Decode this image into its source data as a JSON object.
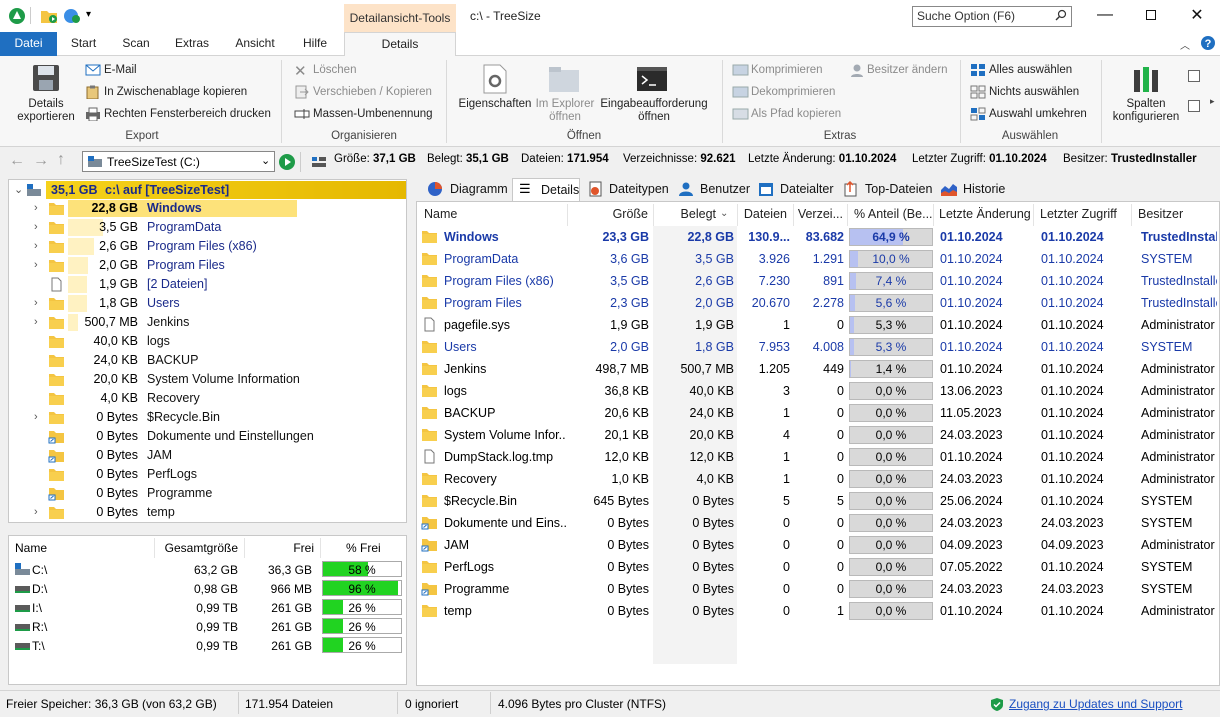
{
  "window": {
    "title": "c:\\ - TreeSize",
    "context_tab": "Detailansicht-Tools",
    "search_placeholder": "Suche Option (F6)"
  },
  "ribbon_tabs": [
    "Datei",
    "Start",
    "Scan",
    "Extras",
    "Ansicht",
    "Hilfe",
    "Details"
  ],
  "ribbon": {
    "export": {
      "group": "Export",
      "details_export": "Details\nexportieren",
      "email": "E-Mail",
      "clipboard": "In Zwischenablage kopieren",
      "print": "Rechten Fensterbereich drucken"
    },
    "organize": {
      "group": "Organisieren",
      "delete": "Löschen",
      "move": "Verschieben / Kopieren",
      "rename": "Massen-Umbenennung"
    },
    "open": {
      "group": "Öffnen",
      "properties": "Eigenschaften",
      "explorer": "Im Explorer\nöffnen",
      "cmd": "Eingabeaufforderung\nöffnen"
    },
    "extras": {
      "group": "Extras",
      "compress": "Komprimieren",
      "decompress": "Dekomprimieren",
      "copy_path": "Als Pfad kopieren",
      "owner": "Besitzer ändern"
    },
    "select": {
      "group": "Auswählen",
      "all": "Alles auswählen",
      "none": "Nichts auswählen",
      "invert": "Auswahl umkehren"
    },
    "columns": {
      "label": "Spalten\nkonfigurieren"
    }
  },
  "address": {
    "drive": "TreeSizeTest (C:)",
    "stats": [
      {
        "label": "Größe:",
        "value": "37,1 GB"
      },
      {
        "label": "Belegt:",
        "value": "35,1 GB"
      },
      {
        "label": "Dateien:",
        "value": "171.954"
      },
      {
        "label": "Verzeichnisse:",
        "value": "92.621"
      },
      {
        "label": "Letzte Änderung:",
        "value": "01.10.2024"
      },
      {
        "label": "Letzter Zugriff:",
        "value": "01.10.2024"
      },
      {
        "label": "Besitzer:",
        "value": "TrustedInstaller"
      }
    ]
  },
  "tree": {
    "root": {
      "size": "35,1 GB",
      "label": "c:\\  auf  [TreeSizeTest]"
    },
    "items": [
      {
        "size": "22,8 GB",
        "name": "Windows",
        "pct": 64.9,
        "exp": true,
        "icon": "folder"
      },
      {
        "size": "3,5 GB",
        "name": "ProgramData",
        "pct": 10.0,
        "exp": true,
        "icon": "folder"
      },
      {
        "size": "2,6 GB",
        "name": "Program Files (x86)",
        "pct": 7.4,
        "exp": true,
        "icon": "folder"
      },
      {
        "size": "2,0 GB",
        "name": "Program Files",
        "pct": 5.6,
        "exp": true,
        "icon": "folder"
      },
      {
        "size": "1,9 GB",
        "name": "[2 Dateien]",
        "pct": 5.3,
        "exp": false,
        "icon": "file"
      },
      {
        "size": "1,8 GB",
        "name": "Users",
        "pct": 5.3,
        "exp": true,
        "icon": "folder"
      },
      {
        "size": "500,7 MB",
        "name": "Jenkins",
        "pct": 1.4,
        "exp": true,
        "icon": "folder"
      },
      {
        "size": "40,0 KB",
        "name": "logs",
        "pct": 0,
        "exp": false,
        "icon": "folder"
      },
      {
        "size": "24,0 KB",
        "name": "BACKUP",
        "pct": 0,
        "exp": false,
        "icon": "folder"
      },
      {
        "size": "20,0 KB",
        "name": "System Volume Information",
        "pct": 0,
        "exp": false,
        "icon": "folder"
      },
      {
        "size": "4,0 KB",
        "name": "Recovery",
        "pct": 0,
        "exp": false,
        "icon": "folder"
      },
      {
        "size": "0 Bytes",
        "name": "$Recycle.Bin",
        "pct": 0,
        "exp": true,
        "icon": "folder"
      },
      {
        "size": "0 Bytes",
        "name": "Dokumente und Einstellungen",
        "pct": 0,
        "exp": false,
        "icon": "link"
      },
      {
        "size": "0 Bytes",
        "name": "JAM",
        "pct": 0,
        "exp": false,
        "icon": "link"
      },
      {
        "size": "0 Bytes",
        "name": "PerfLogs",
        "pct": 0,
        "exp": false,
        "icon": "folder"
      },
      {
        "size": "0 Bytes",
        "name": "Programme",
        "pct": 0,
        "exp": false,
        "icon": "link"
      },
      {
        "size": "0 Bytes",
        "name": "temp",
        "pct": 0,
        "exp": true,
        "icon": "folder"
      }
    ]
  },
  "drives": {
    "headers": [
      "Name",
      "Gesamtgröße",
      "Frei",
      "% Frei"
    ],
    "rows": [
      {
        "name": "C:\\",
        "total": "63,2 GB",
        "free": "36,3 GB",
        "pct": "58 %",
        "pct_val": 58
      },
      {
        "name": "D:\\",
        "total": "0,98 GB",
        "free": "966 MB",
        "pct": "96 %",
        "pct_val": 96
      },
      {
        "name": "I:\\",
        "total": "0,99 TB",
        "free": "261 GB",
        "pct": "26 %",
        "pct_val": 26
      },
      {
        "name": "R:\\",
        "total": "0,99 TB",
        "free": "261 GB",
        "pct": "26 %",
        "pct_val": 26
      },
      {
        "name": "T:\\",
        "total": "0,99 TB",
        "free": "261 GB",
        "pct": "26 %",
        "pct_val": 26
      }
    ]
  },
  "view_tabs": [
    "Diagramm",
    "Details",
    "Dateitypen",
    "Benutzer",
    "Dateialter",
    "Top-Dateien",
    "Historie"
  ],
  "details": {
    "headers": [
      "Name",
      "Größe",
      "Belegt",
      "Dateien",
      "Verzei...",
      "% Anteil (Be...",
      "Letzte Änderung",
      "Letzter Zugriff",
      "Besitzer"
    ],
    "rows": [
      {
        "name": "Windows",
        "size": "23,3 GB",
        "used": "22,8 GB",
        "files": "130.9...",
        "dirs": "83.682",
        "pct": "64,9 %",
        "pct_val": 64.9,
        "mod": "01.10.2024",
        "acc": "01.10.2024",
        "owner": "TrustedInstal",
        "icon": "folder",
        "style": "bold"
      },
      {
        "name": "ProgramData",
        "size": "3,6 GB",
        "used": "3,5 GB",
        "files": "3.926",
        "dirs": "1.291",
        "pct": "10,0 %",
        "pct_val": 10.0,
        "mod": "01.10.2024",
        "acc": "01.10.2024",
        "owner": "SYSTEM",
        "icon": "folder",
        "style": "blue"
      },
      {
        "name": "Program Files (x86)",
        "size": "3,5 GB",
        "used": "2,6 GB",
        "files": "7.230",
        "dirs": "891",
        "pct": "7,4 %",
        "pct_val": 7.4,
        "mod": "01.10.2024",
        "acc": "01.10.2024",
        "owner": "TrustedInstalle",
        "icon": "folder",
        "style": "blue"
      },
      {
        "name": "Program Files",
        "size": "2,3 GB",
        "used": "2,0 GB",
        "files": "20.670",
        "dirs": "2.278",
        "pct": "5,6 %",
        "pct_val": 5.6,
        "mod": "01.10.2024",
        "acc": "01.10.2024",
        "owner": "TrustedInstalle",
        "icon": "folder",
        "style": "blue"
      },
      {
        "name": "pagefile.sys",
        "size": "1,9 GB",
        "used": "1,9 GB",
        "files": "1",
        "dirs": "0",
        "pct": "5,3 %",
        "pct_val": 5.3,
        "mod": "01.10.2024",
        "acc": "01.10.2024",
        "owner": "Administrator",
        "icon": "file",
        "style": ""
      },
      {
        "name": "Users",
        "size": "2,0 GB",
        "used": "1,8 GB",
        "files": "7.953",
        "dirs": "4.008",
        "pct": "5,3 %",
        "pct_val": 5.3,
        "mod": "01.10.2024",
        "acc": "01.10.2024",
        "owner": "SYSTEM",
        "icon": "folder",
        "style": "blue"
      },
      {
        "name": "Jenkins",
        "size": "498,7 MB",
        "used": "500,7 MB",
        "files": "1.205",
        "dirs": "449",
        "pct": "1,4 %",
        "pct_val": 1.4,
        "mod": "01.10.2024",
        "acc": "01.10.2024",
        "owner": "Administrator",
        "icon": "folder",
        "style": ""
      },
      {
        "name": "logs",
        "size": "36,8 KB",
        "used": "40,0 KB",
        "files": "3",
        "dirs": "0",
        "pct": "0,0 %",
        "pct_val": 0,
        "mod": "13.06.2023",
        "acc": "01.10.2024",
        "owner": "Administrator",
        "icon": "folder",
        "style": ""
      },
      {
        "name": "BACKUP",
        "size": "20,6 KB",
        "used": "24,0 KB",
        "files": "1",
        "dirs": "0",
        "pct": "0,0 %",
        "pct_val": 0,
        "mod": "11.05.2023",
        "acc": "01.10.2024",
        "owner": "Administrator",
        "icon": "folder",
        "style": ""
      },
      {
        "name": "System Volume Infor...",
        "size": "20,1 KB",
        "used": "20,0 KB",
        "files": "4",
        "dirs": "0",
        "pct": "0,0 %",
        "pct_val": 0,
        "mod": "24.03.2023",
        "acc": "01.10.2024",
        "owner": "Administrator",
        "icon": "folder",
        "style": ""
      },
      {
        "name": "DumpStack.log.tmp",
        "size": "12,0 KB",
        "used": "12,0 KB",
        "files": "1",
        "dirs": "0",
        "pct": "0,0 %",
        "pct_val": 0,
        "mod": "01.10.2024",
        "acc": "01.10.2024",
        "owner": "Administrator",
        "icon": "file",
        "style": ""
      },
      {
        "name": "Recovery",
        "size": "1,0 KB",
        "used": "4,0 KB",
        "files": "1",
        "dirs": "0",
        "pct": "0,0 %",
        "pct_val": 0,
        "mod": "24.03.2023",
        "acc": "01.10.2024",
        "owner": "Administrator",
        "icon": "folder",
        "style": ""
      },
      {
        "name": "$Recycle.Bin",
        "size": "645 Bytes",
        "used": "0 Bytes",
        "files": "5",
        "dirs": "5",
        "pct": "0,0 %",
        "pct_val": 0,
        "mod": "25.06.2024",
        "acc": "01.10.2024",
        "owner": "SYSTEM",
        "icon": "folder",
        "style": ""
      },
      {
        "name": "Dokumente und Eins...",
        "size": "0 Bytes",
        "used": "0 Bytes",
        "files": "0",
        "dirs": "0",
        "pct": "0,0 %",
        "pct_val": 0,
        "mod": "24.03.2023",
        "acc": "24.03.2023",
        "owner": "SYSTEM",
        "icon": "link",
        "style": ""
      },
      {
        "name": "JAM",
        "size": "0 Bytes",
        "used": "0 Bytes",
        "files": "0",
        "dirs": "0",
        "pct": "0,0 %",
        "pct_val": 0,
        "mod": "04.09.2023",
        "acc": "04.09.2023",
        "owner": "Administrator",
        "icon": "link",
        "style": ""
      },
      {
        "name": "PerfLogs",
        "size": "0 Bytes",
        "used": "0 Bytes",
        "files": "0",
        "dirs": "0",
        "pct": "0,0 %",
        "pct_val": 0,
        "mod": "07.05.2022",
        "acc": "01.10.2024",
        "owner": "SYSTEM",
        "icon": "folder",
        "style": ""
      },
      {
        "name": "Programme",
        "size": "0 Bytes",
        "used": "0 Bytes",
        "files": "0",
        "dirs": "0",
        "pct": "0,0 %",
        "pct_val": 0,
        "mod": "24.03.2023",
        "acc": "24.03.2023",
        "owner": "SYSTEM",
        "icon": "link",
        "style": ""
      },
      {
        "name": "temp",
        "size": "0 Bytes",
        "used": "0 Bytes",
        "files": "0",
        "dirs": "1",
        "pct": "0,0 %",
        "pct_val": 0,
        "mod": "01.10.2024",
        "acc": "01.10.2024",
        "owner": "Administrator",
        "icon": "folder",
        "style": ""
      }
    ]
  },
  "status": {
    "free": "Freier Speicher: 36,3 GB  (von 63,2 GB)",
    "files": "171.954 Dateien",
    "ignored": "0 ignoriert",
    "cluster": "4.096 Bytes pro Cluster (NTFS)",
    "support": "Zugang zu Updates und Support"
  },
  "colors": {
    "accent": "#1f6fc1",
    "link": "#1a3aa8",
    "free_bar": "#21d321",
    "pct_bar": "#b7c1f1",
    "root_bar": "#e5b800"
  }
}
